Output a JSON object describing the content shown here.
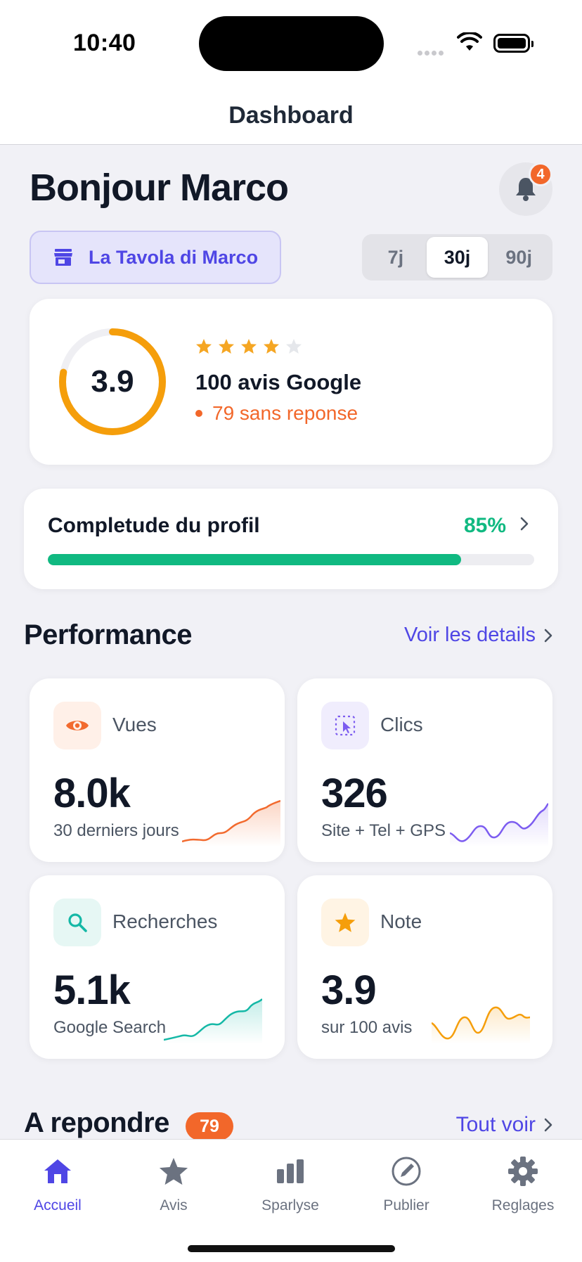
{
  "status_bar": {
    "time": "10:40"
  },
  "nav": {
    "title": "Dashboard"
  },
  "greeting": "Bonjour Marco",
  "notifications": {
    "count": "4"
  },
  "business": {
    "name": "La Tavola di Marco"
  },
  "period": {
    "options": [
      "7j",
      "30j",
      "90j"
    ],
    "selected": "30j"
  },
  "rating": {
    "value": "3.9",
    "stars_filled": 4,
    "stars_total": 5,
    "reviews_label": "100 avis Google",
    "unanswered_label": "79 sans reponse",
    "ring_fraction": 0.78
  },
  "profile": {
    "title": "Completude du profil",
    "percent_label": "85%",
    "percent": 85
  },
  "performance": {
    "title": "Performance",
    "details_link": "Voir les details",
    "metrics": [
      {
        "label": "Vues",
        "value": "8.0k",
        "sub": "30 derniers jours",
        "icon": "eye-icon",
        "color": "#f26a2e"
      },
      {
        "label": "Clics",
        "value": "326",
        "sub": "Site + Tel + GPS",
        "icon": "click-icon",
        "color": "#7c5cf0"
      },
      {
        "label": "Recherches",
        "value": "5.1k",
        "sub": "Google Search",
        "icon": "search-icon",
        "color": "#14b8a6"
      },
      {
        "label": "Note",
        "value": "3.9",
        "sub": "sur 100 avis",
        "icon": "star-icon",
        "color": "#f59e0b"
      }
    ]
  },
  "to_reply": {
    "title": "A repondre",
    "count": "79",
    "link": "Tout voir"
  },
  "tabbar": {
    "items": [
      {
        "label": "Accueil",
        "icon": "home-icon",
        "active": true
      },
      {
        "label": "Avis",
        "icon": "star-icon",
        "active": false
      },
      {
        "label": "Sparlyse",
        "icon": "bar-chart-icon",
        "active": false
      },
      {
        "label": "Publier",
        "icon": "compose-icon",
        "active": false
      },
      {
        "label": "Reglages",
        "icon": "gear-icon",
        "active": false
      }
    ]
  },
  "colors": {
    "accent": "#4f46e5",
    "orange": "#f2672a",
    "green": "#10b981",
    "star": "#f5a623"
  }
}
